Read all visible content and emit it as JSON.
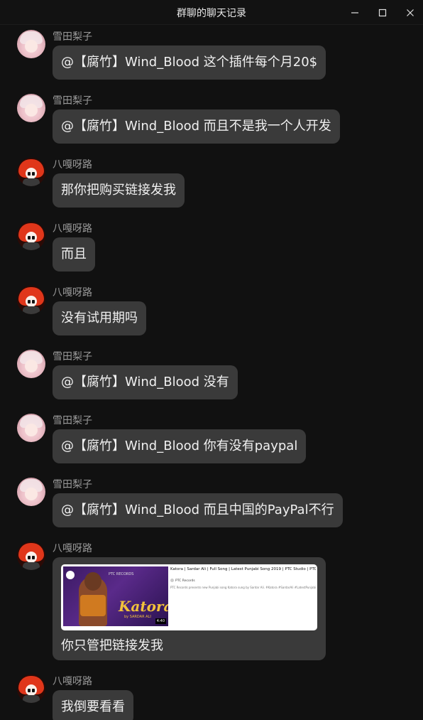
{
  "window": {
    "title": "群聊的聊天记录",
    "minimize_icon": "minimize-icon",
    "maximize_icon": "maximize-icon",
    "close_icon": "close-icon"
  },
  "messages": [
    {
      "sender": "雪田梨子",
      "text": "@【腐竹】Wind_Blood 这个插件每个月20$"
    },
    {
      "sender": "雪田梨子",
      "text": "@【腐竹】Wind_Blood 而且不是我一个人开发"
    },
    {
      "sender": "八嘎呀路",
      "text": "那你把购买链接发我"
    },
    {
      "sender": "八嘎呀路",
      "text": "而且"
    },
    {
      "sender": "八嘎呀路",
      "text": "没有试用期吗"
    },
    {
      "sender": "雪田梨子",
      "text": "@【腐竹】Wind_Blood 没有"
    },
    {
      "sender": "雪田梨子",
      "text": "@【腐竹】Wind_Blood 你有没有paypal"
    },
    {
      "sender": "雪田梨子",
      "text": "@【腐竹】Wind_Blood 而且中国的PayPal不行"
    },
    {
      "sender": "八嘎呀路",
      "text": "你只管把链接发我",
      "link_card": {
        "title": "Katora | Sardar Ali | Full Song | Latest Punjabi Song 2019 | PTC Studio | PTC Records",
        "channel": "PTC Records",
        "description": "PTC Records presents new Punjabi song Katora sung by Sardar Ali. #Katora #SardarAli #LatestPunjabiSong2019 #PTCRecords",
        "thumb_label": "PTC RECORDS",
        "thumb_title": "Katora",
        "thumb_sub": "by SARDAR ALI",
        "thumb_duration": "4:40"
      }
    },
    {
      "sender": "八嘎呀路",
      "text": "我倒要看看"
    }
  ]
}
